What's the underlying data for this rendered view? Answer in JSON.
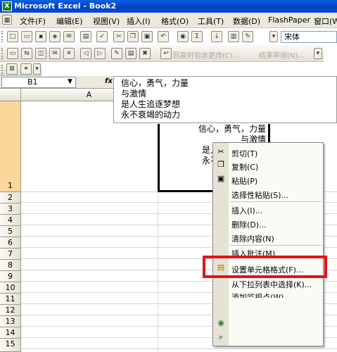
{
  "window": {
    "title": "Microsoft Excel - Book2",
    "app_icon": "X"
  },
  "menu": [
    {
      "label": "文件(F)"
    },
    {
      "label": "编辑(E)"
    },
    {
      "label": "视图(V)"
    },
    {
      "label": "插入(I)"
    },
    {
      "label": "格式(O)"
    },
    {
      "label": "工具(T)"
    },
    {
      "label": "数据(D)"
    },
    {
      "label": "FlashPaper"
    },
    {
      "label": "窗口(W)"
    }
  ],
  "toolbar": {
    "font_name": "宋体",
    "reply_changes": "回复时包含更改(C)...",
    "end_review": "结束审阅(N)..."
  },
  "formula_bar": {
    "name_box": "B1",
    "fx": "fx",
    "content": [
      "信心，勇气，力量",
      "与激情",
      "是人生追逐梦想",
      "永不衰竭的动力"
    ]
  },
  "columns": [
    "A"
  ],
  "rows": [
    "1",
    "2",
    "3",
    "4",
    "5",
    "6",
    "7",
    "8",
    "9",
    "10",
    "11",
    "12",
    "13",
    "14",
    "15"
  ],
  "cell_visible_text": [
    "信心，勇气，力量",
    "与激情",
    "是人",
    "永不"
  ],
  "context_menu": [
    {
      "label": "剪切(T)",
      "icon": "scissors-icon"
    },
    {
      "label": "复制(C)",
      "icon": "copy-icon"
    },
    {
      "label": "粘贴(P)",
      "icon": "paste-icon"
    },
    {
      "label": "选择性粘贴(S)..."
    },
    {
      "label": "插入(I)..."
    },
    {
      "label": "删除(D)..."
    },
    {
      "label": "清除内容(N)"
    },
    {
      "label": "插入批注(M)"
    },
    {
      "label": "设置单元格格式(F)...",
      "icon": "format-cells-icon"
    },
    {
      "label": "从下拉列表中选择(K)..."
    },
    {
      "label": "添加监视点(W)"
    }
  ],
  "colors": {
    "title_bar": "#0a4bd0",
    "highlight_box": "#e0141a",
    "menu_bg": "#ebe8dc"
  }
}
